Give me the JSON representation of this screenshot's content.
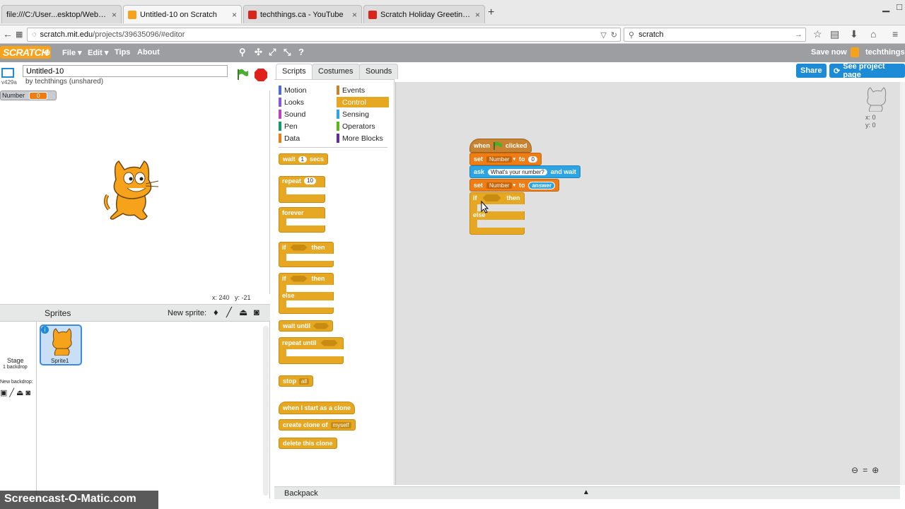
{
  "browser": {
    "tabs": [
      {
        "label": "file:///C:/User...esktop/Web.htm",
        "color": "#e0e0e0"
      },
      {
        "label": "Untitled-10 on Scratch",
        "color": "#f7a21b"
      },
      {
        "label": "techthings.ca - YouTube",
        "color": "#d9251b"
      },
      {
        "label": "Scratch Holiday Greeting - ...",
        "color": "#d9251b"
      }
    ],
    "new_tab": "+",
    "url": "scratch.mit.edu/projects/39635096/#editor",
    "url_host": "scratch.mit.edu",
    "url_path": "/projects/39635096/#editor",
    "search": "scratch"
  },
  "menubar": {
    "logo": "SCRATCH",
    "file": "File ▾",
    "edit": "Edit ▾",
    "tips": "Tips",
    "about": "About",
    "save_now": "Save now",
    "user": "techthings"
  },
  "project": {
    "title": "Untitled-10",
    "author": "by techthings (unshared)",
    "version": "v429a",
    "share": "Share",
    "see_project_page": "See project page"
  },
  "stage": {
    "monitor_label": "Number",
    "monitor_value": "0",
    "coords_x": "x: 240",
    "coords_y": "y: -21"
  },
  "sprites": {
    "header": "Sprites",
    "new_sprite": "New sprite:",
    "stage_label": "Stage",
    "backdrop_count": "1 backdrop",
    "new_backdrop": "New backdrop:",
    "sprite1": "Sprite1"
  },
  "tabs": {
    "scripts": "Scripts",
    "costumes": "Costumes",
    "sounds": "Sounds"
  },
  "categories": [
    {
      "label": "Motion",
      "color": "#4a6cd4"
    },
    {
      "label": "Looks",
      "color": "#8a55d7"
    },
    {
      "label": "Sound",
      "color": "#bb42c3"
    },
    {
      "label": "Pen",
      "color": "#0e9a6c"
    },
    {
      "label": "Data",
      "color": "#ee7d16"
    },
    {
      "label": "Events",
      "color": "#c88330"
    },
    {
      "label": "Control",
      "color": "#e6a822"
    },
    {
      "label": "Sensing",
      "color": "#2ca5e2"
    },
    {
      "label": "Operators",
      "color": "#5cb712"
    },
    {
      "label": "More Blocks",
      "color": "#632d99"
    }
  ],
  "palette": {
    "wait": "wait",
    "wait_val": "1",
    "secs": "secs",
    "repeat": "repeat",
    "repeat_val": "10",
    "forever": "forever",
    "if": "if",
    "then": "then",
    "else": "else",
    "wait_until": "wait until",
    "repeat_until": "repeat until",
    "stop": "stop",
    "stop_val": "all",
    "clone_start": "when I start as a clone",
    "create_clone": "create clone of",
    "clone_val": "myself",
    "delete_clone": "delete this clone"
  },
  "script": {
    "when": "when",
    "clicked": "clicked",
    "set": "set",
    "var": "Number",
    "to": "to",
    "zero": "0",
    "ask": "ask",
    "question": "What's your number?",
    "and_wait": "and wait",
    "answer": "answer",
    "if": "if",
    "then": "then",
    "else": "else"
  },
  "sprite_info": {
    "x": "x: 0",
    "y": "y: 0"
  },
  "backpack": "Backpack",
  "watermark": "Screencast-O-Matic.com"
}
